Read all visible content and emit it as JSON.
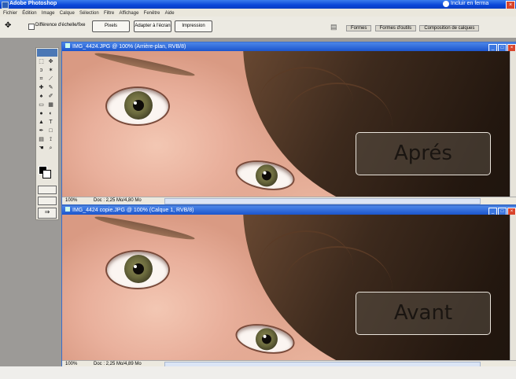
{
  "app": {
    "title": "Adobe Photoshop",
    "help_label": "Incluir en ferma",
    "close_label": "×"
  },
  "menubar": {
    "items": [
      "Fichier",
      "Édition",
      "Image",
      "Calque",
      "Sélection",
      "Filtre",
      "Affichage",
      "Fenêtre",
      "Aide"
    ]
  },
  "options": {
    "tool_icon": "move-icon",
    "check_label": "Différence d'échelle/fixe",
    "buttons": [
      "Pixels",
      "Adapter à l'écran",
      "Impression"
    ],
    "tabs": [
      "Formes",
      "Formes d'outils",
      "Composition de calques"
    ]
  },
  "windows": [
    {
      "title": "IMG_4424.JPG @ 100% (Arrière-plan, RVB/8)",
      "overlay": "Aprés",
      "status_zoom": "100%",
      "status_info": "Doc : 2,25 Mo/4,80 Mo"
    },
    {
      "title": "IMG_4424 copie.JPG @ 100% (Calque 1, RVB/8)",
      "overlay": "Avant",
      "status_zoom": "100%",
      "status_info": "Doc : 2,25 Mo/4,89 Mo"
    }
  ],
  "window_buttons": [
    "_",
    "□",
    "×"
  ]
}
